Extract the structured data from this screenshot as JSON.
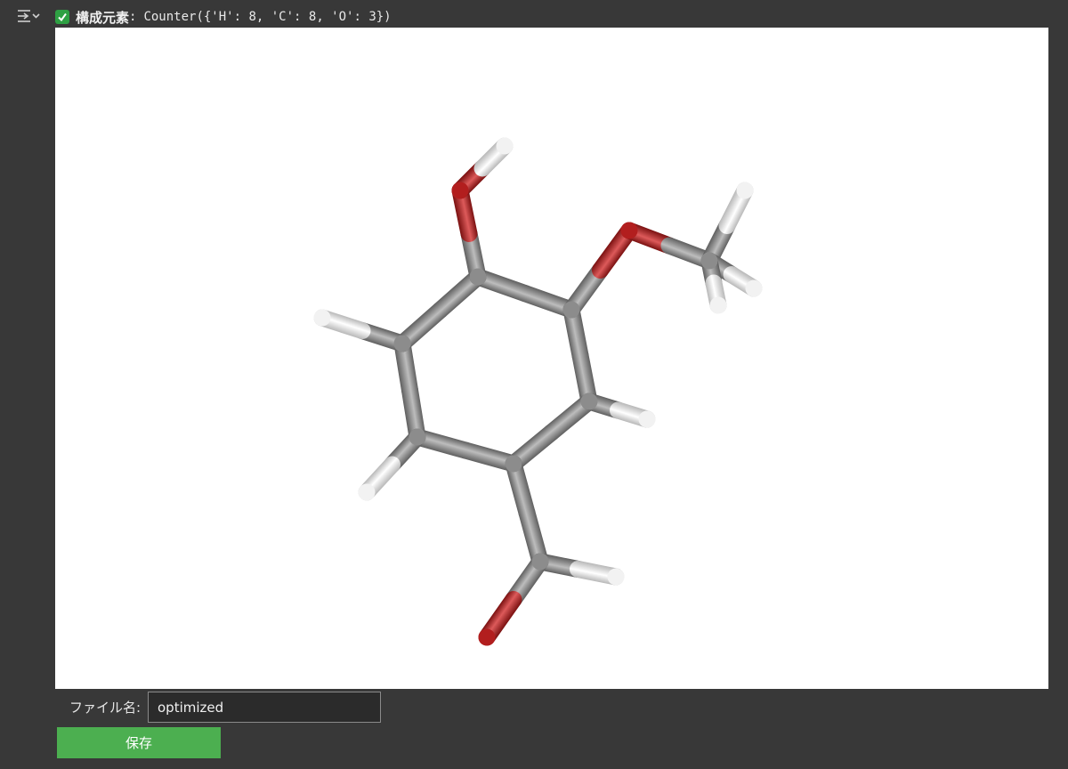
{
  "output": {
    "status_icon": "check-icon",
    "status_color": "#2ea043",
    "label": "構成元素",
    "separator": ":",
    "value": "Counter({'H': 8, 'C': 8, 'O': 3})"
  },
  "molecule": {
    "viewer_background": "#ffffff",
    "colors": {
      "C": "#8c8c8c",
      "O": "#b21e1e",
      "H": "#f2f2f2"
    }
  },
  "form": {
    "filename_label": "ファイル名:",
    "filename_value": "optimized",
    "save_label": "保存",
    "save_color": "#4caf50"
  }
}
